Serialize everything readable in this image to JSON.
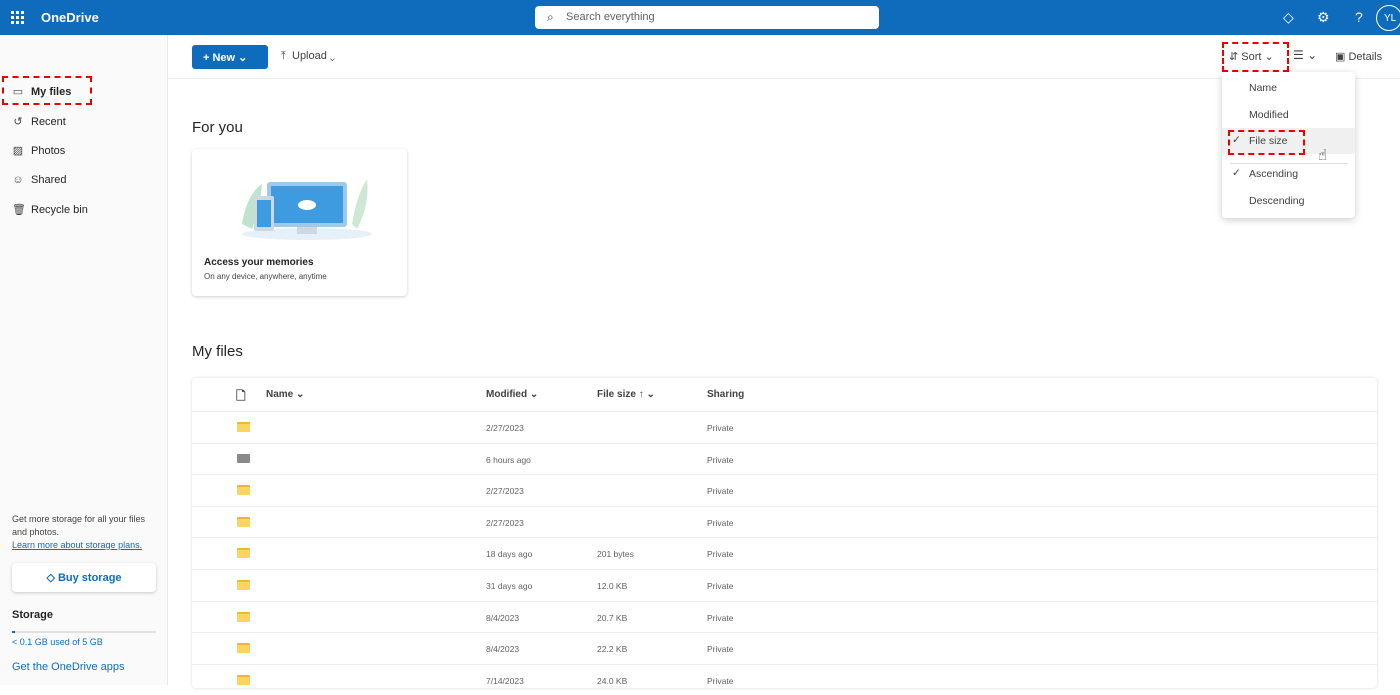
{
  "header": {
    "app_name": "OneDrive",
    "search_placeholder": "Search everything",
    "avatar_initials": "YL"
  },
  "sidebar": {
    "items": [
      {
        "label": "My files",
        "icon": "folder-icon"
      },
      {
        "label": "Recent",
        "icon": "history-icon"
      },
      {
        "label": "Photos",
        "icon": "image-icon"
      },
      {
        "label": "Shared",
        "icon": "people-icon"
      },
      {
        "label": "Recycle bin",
        "icon": "trash-icon"
      }
    ],
    "promo_text": "Get more storage for all your files and photos.",
    "promo_link": "Learn more about storage plans.",
    "buy_label": "Buy storage",
    "storage_title": "Storage",
    "storage_used": "< 0.1 GB used of 5 GB",
    "storage_fraction": 0.02,
    "apps_link": "Get the OneDrive apps"
  },
  "toolbar": {
    "new_label": "New",
    "upload_label": "Upload",
    "sort_label": "Sort",
    "details_label": "Details"
  },
  "sort_menu": {
    "items": [
      {
        "label": "Name",
        "checked": false
      },
      {
        "label": "Modified",
        "checked": false
      },
      {
        "label": "File size",
        "checked": true
      },
      {
        "label": "Ascending",
        "checked": true
      },
      {
        "label": "Descending",
        "checked": false
      }
    ]
  },
  "for_you": {
    "title": "For you",
    "card_title": "Access your memories",
    "card_subtitle": "On any device, anywhere, anytime"
  },
  "files": {
    "title": "My files",
    "columns": {
      "name": "Name",
      "modified": "Modified",
      "size": "File size",
      "sharing": "Sharing"
    },
    "rows": [
      {
        "type": "folder",
        "modified": "2/27/2023",
        "size": "",
        "sharing": "Private"
      },
      {
        "type": "vault",
        "modified": "6 hours ago",
        "size": "",
        "sharing": "Private"
      },
      {
        "type": "folder",
        "modified": "2/27/2023",
        "size": "",
        "sharing": "Private"
      },
      {
        "type": "folder",
        "modified": "2/27/2023",
        "size": "",
        "sharing": "Private"
      },
      {
        "type": "folder",
        "modified": "18 days ago",
        "size": "201 bytes",
        "sharing": "Private"
      },
      {
        "type": "folder",
        "modified": "31 days ago",
        "size": "12.0 KB",
        "sharing": "Private"
      },
      {
        "type": "folder",
        "modified": "8/4/2023",
        "size": "20.7 KB",
        "sharing": "Private"
      },
      {
        "type": "folder",
        "modified": "8/4/2023",
        "size": "22.2 KB",
        "sharing": "Private"
      },
      {
        "type": "folder",
        "modified": "7/14/2023",
        "size": "24.0 KB",
        "sharing": "Private"
      }
    ]
  }
}
